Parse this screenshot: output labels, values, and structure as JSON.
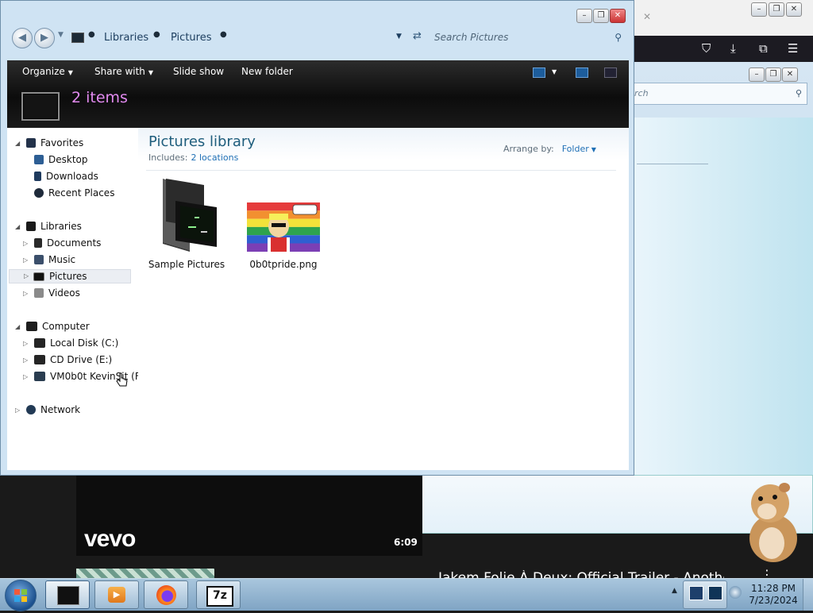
{
  "explorer": {
    "address": {
      "crumbs": [
        "Libraries",
        "Pictures"
      ]
    },
    "search": {
      "placeholder": "Search Pictures"
    },
    "toolbar": {
      "organize": "Organize",
      "share_with": "Share with",
      "slide_show": "Slide show",
      "new_folder": "New folder"
    },
    "header": {
      "item_count": "2 items"
    },
    "nav": {
      "favorites": {
        "label": "Favorites",
        "items": [
          "Desktop",
          "Downloads",
          "Recent Places"
        ]
      },
      "libraries": {
        "label": "Libraries",
        "items": [
          "Documents",
          "Music",
          "Pictures",
          "Videos"
        ]
      },
      "computer": {
        "label": "Computer",
        "items": [
          "Local Disk (C:)",
          "CD Drive (E:)",
          "VM0b0t KevinSit (F"
        ]
      },
      "network": {
        "label": "Network"
      }
    },
    "library": {
      "title": "Pictures library",
      "includes_label": "Includes:",
      "includes_link": "2 locations",
      "arrange_label": "Arrange by:",
      "arrange_value": "Folder"
    },
    "files": [
      {
        "name": "Sample Pictures",
        "icon": "folder-icon"
      },
      {
        "name": "0b0tpride.png",
        "icon": "image-thumbnail"
      }
    ]
  },
  "background": {
    "browser_search_partial": "rch",
    "vevo": "vevo",
    "video_time": "6:09",
    "video_title": "Jakem Folie À Deux: Official Trailer - Another"
  },
  "taskbar": {
    "time": "11:28 PM",
    "date": "7/23/2024",
    "apps": [
      "explorer",
      "media-player",
      "firefox",
      "7-zip"
    ],
    "seven_zip_label": "7z"
  },
  "colors": {
    "item_count": "#e28af0",
    "library_title": "#1e5d7c",
    "link": "#1e6fb5",
    "command_bar": "#0c0c0c"
  }
}
